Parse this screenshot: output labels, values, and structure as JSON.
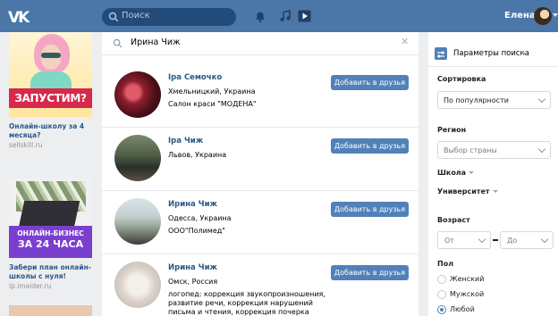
{
  "header": {
    "logo": "VK",
    "search_placeholder": "Поиск",
    "user_name": "Елена"
  },
  "ads": [
    {
      "banner_text": "ЗАПУСТИМ?",
      "title": "Онлайн-школу за 4 месяца?",
      "domain": "sellskill.ru"
    },
    {
      "banner_line1": "ОНЛАЙН-БИЗНЕС",
      "banner_line2": "ЗА 24 ЧАСА",
      "title": "Забери план онлайн-школы с нуля!",
      "domain": "lp.imaider.ru"
    }
  ],
  "search": {
    "query": "Ирина Чиж"
  },
  "results": [
    {
      "name": "Іра Семочко",
      "lines": [
        "Хмельницкий, Украина",
        "Салон краси \"МОДЕНА\""
      ],
      "button": "Добавить в друзья"
    },
    {
      "name": "Іра Чиж",
      "lines": [
        "Львов, Украина"
      ],
      "button": "Добавить в друзья"
    },
    {
      "name": "Ирина Чиж",
      "lines": [
        "Одесса, Украина",
        "ООО\"Полимед\""
      ],
      "button": "Добавить в друзья"
    },
    {
      "name": "Ирина Чиж",
      "lines": [
        "Омск, Россия",
        "логопед: коррекция звукопроизношения,",
        "развитие речи, коррекция нарушений",
        "письма и чтения, коррекция почерка"
      ],
      "button": "Добавить в друзья"
    }
  ],
  "filters": {
    "title": "Параметры поиска",
    "sort_label": "Сортировка",
    "sort_value": "По популярности",
    "region_label": "Регион",
    "region_placeholder": "Выбор страны",
    "school_label": "Школа",
    "university_label": "Университет",
    "age_label": "Возраст",
    "age_from": "От",
    "age_to": "До",
    "gender_label": "Пол",
    "gender_options": [
      "Женский",
      "Мужской",
      "Любой"
    ],
    "gender_selected": "Любой"
  },
  "colors": {
    "header_bg": "#4a76a8",
    "accent": "#5181b8",
    "link": "#2a5885",
    "page_bg": "#edeef0"
  }
}
